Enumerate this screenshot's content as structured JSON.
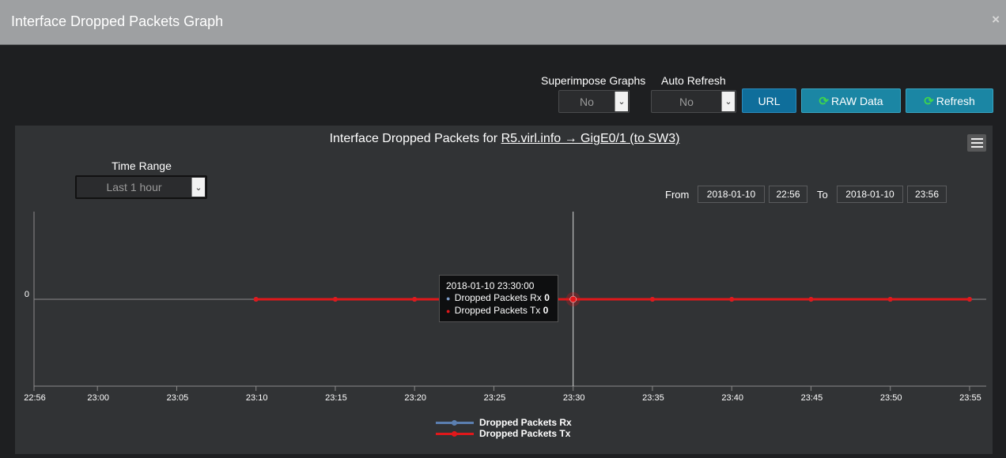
{
  "window": {
    "title": "Interface Dropped Packets Graph",
    "close_glyph": "×"
  },
  "controls": {
    "superimpose": {
      "label": "Superimpose Graphs",
      "value": "No"
    },
    "auto_refresh": {
      "label": "Auto Refresh",
      "value": "No"
    },
    "url_button": "URL",
    "raw_button": "RAW Data",
    "refresh_button": "Refresh",
    "refresh_icon": "refresh-icon"
  },
  "chart_header": {
    "prefix": "Interface Dropped Packets for ",
    "link": "R5.virl.info → GigE0/1 (to SW3)",
    "menu_icon": "hamburger-menu-icon"
  },
  "time_range": {
    "label": "Time Range",
    "value": "Last 1 hour"
  },
  "date_range": {
    "from_label": "From",
    "from_date": "2018-01-10",
    "from_time": "22:56",
    "to_label": "To",
    "to_date": "2018-01-10",
    "to_time": "23:56"
  },
  "tooltip": {
    "time": "2018-01-10 23:30:00",
    "rx_label": "Dropped Packets Rx",
    "rx_value": "0",
    "tx_label": "Dropped Packets Tx",
    "tx_value": "0"
  },
  "colors": {
    "rx": "#5b7fb0",
    "tx": "#e0181b",
    "button": "#1b86a4"
  },
  "chart_data": {
    "type": "line",
    "title": "Interface Dropped Packets for R5.virl.info → GigE0/1 (to SW3)",
    "x_tick_labels": [
      "22:56",
      "23:00",
      "23:05",
      "23:10",
      "23:15",
      "23:20",
      "23:25",
      "23:30",
      "23:35",
      "23:40",
      "23:45",
      "23:50",
      "23:55"
    ],
    "y_tick_labels": [
      "0"
    ],
    "xlim": [
      "22:56",
      "23:56"
    ],
    "x": [
      "23:10",
      "23:15",
      "23:20",
      "23:25",
      "23:30",
      "23:35",
      "23:40",
      "23:45",
      "23:50",
      "23:55"
    ],
    "series": [
      {
        "name": "Dropped Packets Rx",
        "values": [
          0,
          0,
          0,
          0,
          0,
          0,
          0,
          0,
          0,
          0
        ],
        "color": "#5b7fb0"
      },
      {
        "name": "Dropped Packets Tx",
        "values": [
          0,
          0,
          0,
          0,
          0,
          0,
          0,
          0,
          0,
          0
        ],
        "color": "#e0181b"
      }
    ],
    "hover_x": "23:30",
    "grid": false,
    "legend": "bottom-center"
  }
}
